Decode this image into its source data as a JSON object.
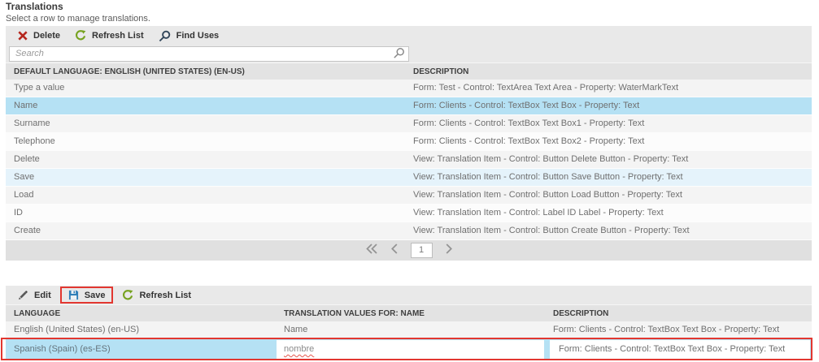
{
  "header": {
    "title": "Translations",
    "subtitle": "Select a row to manage translations."
  },
  "top_toolbar": {
    "delete": "Delete",
    "refresh": "Refresh List",
    "find_uses": "Find Uses"
  },
  "search": {
    "placeholder": "Search"
  },
  "top_table": {
    "columns": {
      "value": "DEFAULT LANGUAGE: ENGLISH (UNITED STATES) (EN-US)",
      "description": "DESCRIPTION"
    },
    "rows": [
      {
        "value": "Type a value",
        "description": "Form: Test - Control: TextArea Text Area - Property: WaterMarkText"
      },
      {
        "value": "Name",
        "description": "Form: Clients - Control: TextBox Text Box - Property: Text",
        "selected": true
      },
      {
        "value": "Surname",
        "description": "Form: Clients - Control: TextBox Text Box1 - Property: Text"
      },
      {
        "value": "Telephone",
        "description": "Form: Clients - Control: TextBox Text Box2 - Property: Text"
      },
      {
        "value": "Delete",
        "description": "View: Translation Item - Control: Button Delete Button - Property: Text"
      },
      {
        "value": "Save",
        "description": "View: Translation Item - Control: Button Save Button - Property: Text",
        "highlighted": true
      },
      {
        "value": "Load",
        "description": "View: Translation Item - Control: Button Load Button - Property: Text"
      },
      {
        "value": "ID",
        "description": "View: Translation Item - Control: Label ID Label - Property: Text"
      },
      {
        "value": "Create",
        "description": "View: Translation Item - Control: Button Create Button - Property: Text"
      }
    ]
  },
  "pagination": {
    "page": "1"
  },
  "bottom_toolbar": {
    "edit": "Edit",
    "save": "Save",
    "refresh": "Refresh List"
  },
  "bottom_table": {
    "columns": {
      "language": "LANGUAGE",
      "value": "TRANSLATION VALUES FOR: NAME",
      "description": "DESCRIPTION"
    },
    "rows": [
      {
        "language": "English (United States) (en-US)",
        "value": "Name",
        "description": "Form: Clients - Control: TextBox Text Box - Property: Text"
      },
      {
        "language": "Spanish (Spain) (es-ES)",
        "value": "nombre",
        "description": "Form: Clients - Control: TextBox Text Box - Property: Text",
        "selected": true,
        "editing": true
      }
    ]
  },
  "colors": {
    "selected_row": "#b5e1f4",
    "secondary_highlight": "#e5f3fb",
    "annotation_red": "#e23730",
    "delete_icon_red": "#b5271e",
    "refresh_icon_green": "#76a21f",
    "save_icon_blue": "#2e7fb8",
    "magnifier_navy": "#33475b"
  }
}
